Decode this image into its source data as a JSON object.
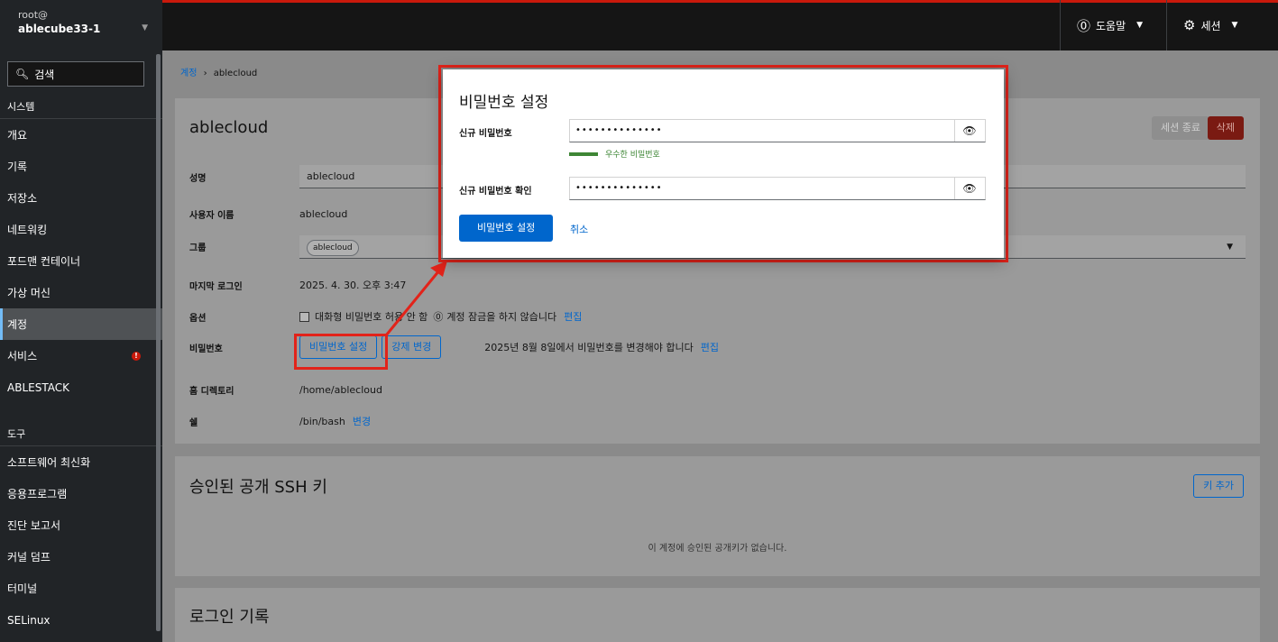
{
  "topbar": {
    "host_user": "root@",
    "host_name": "ablecube33-1",
    "help_label": "도움말",
    "session_label": "세션"
  },
  "sidebar": {
    "search_label": "검색",
    "items": [
      "시스템",
      "개요",
      "기록",
      "저장소",
      "네트워킹",
      "포드맨 컨테이너",
      "가상 머신",
      "계정",
      "서비스",
      "ABLESTACK",
      "도구",
      "소프트웨어 최신화",
      "응용프로그램",
      "진단 보고서",
      "커널 덤프",
      "터미널",
      "SELinux"
    ],
    "badge": "!"
  },
  "breadcrumb": {
    "parent": "계정",
    "separator": "›",
    "current": "ablecloud"
  },
  "account": {
    "title": "ablecloud",
    "end_session_label": "세션 종료",
    "delete_label": "삭제",
    "fields": {
      "full_name_label": "성명",
      "full_name_value": "ablecloud",
      "username_label": "사용자 이름",
      "username_value": "ablecloud",
      "groups_label": "그룹",
      "group_chip": "ablecloud",
      "last_login_label": "마지막 로그인",
      "last_login_value": "2025. 4. 30. 오후 3:47",
      "options_label": "옵션",
      "options_text": "대화형 비밀번호 허용 안 함",
      "lock_text": "계정 잠금을 하지 않습니다",
      "edit_label": "편집",
      "password_label": "비밀번호",
      "set_password_label": "비밀번호 설정",
      "force_change_label": "강제 변경",
      "password_expiry_text": "2025년 8월 8일에서 비밀번호를 변경해야 합니다",
      "home_label": "홈 디렉토리",
      "home_value": "/home/ablecloud",
      "shell_label": "쉘",
      "shell_value": "/bin/bash",
      "change_label": "변경"
    }
  },
  "ssh": {
    "title": "승인된 공개 SSH 키",
    "add_key_label": "키 추가",
    "empty_text": "이 계정에 승인된 공개키가 없습니다."
  },
  "login_history": {
    "title": "로그인 기록"
  },
  "modal": {
    "title": "비밀번호 설정",
    "new_password_label": "신규 비밀번호",
    "new_password_value": "••••••••••••••",
    "strength_text": "우수한 비밀번호",
    "confirm_password_label": "신규 비밀번호 확인",
    "confirm_password_value": "••••••••••••••",
    "submit_label": "비밀번호 설정",
    "cancel_label": "취소"
  },
  "colors": {
    "accent": "#0066cc",
    "danger": "#c9190b",
    "highlight": "#e2231a",
    "success": "#3e8635"
  }
}
